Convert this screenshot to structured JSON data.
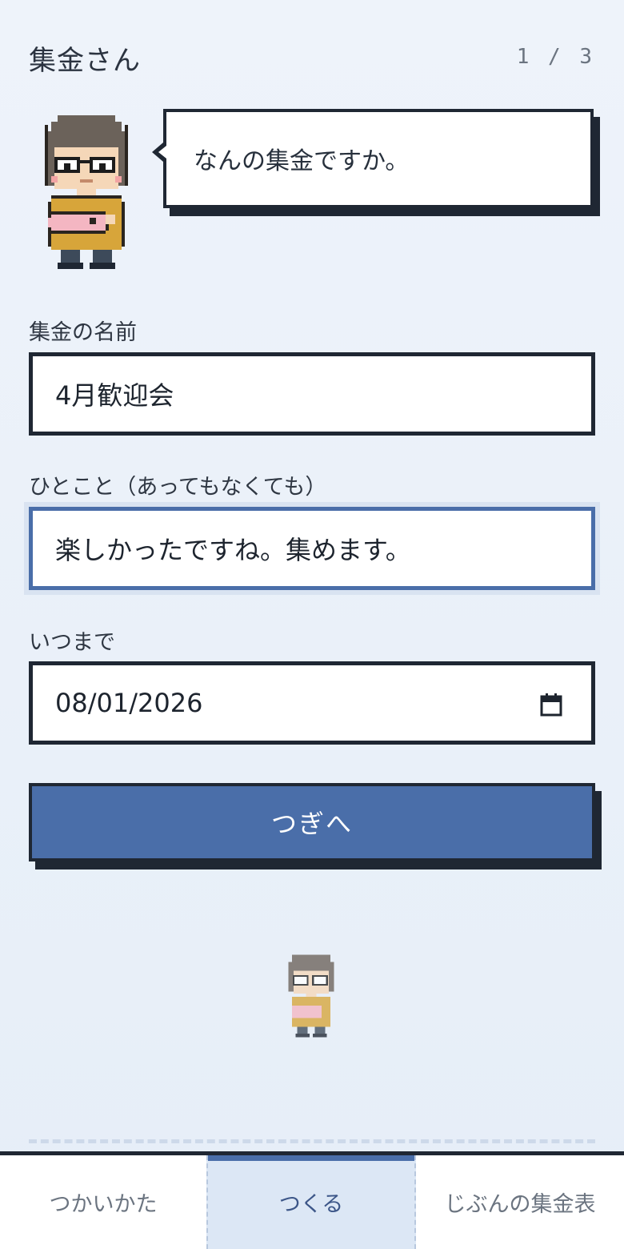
{
  "header": {
    "title": "集金さん",
    "step": "1 / 3"
  },
  "speech": {
    "text": "なんの集金ですか。"
  },
  "form": {
    "name": {
      "label": "集金の名前",
      "value": "4月歓迎会"
    },
    "comment": {
      "label": "ひとこと（あってもなくても）",
      "value": "楽しかったですね。集めます。"
    },
    "deadline": {
      "label": "いつまで",
      "value": "08/01/2026"
    }
  },
  "next_button": {
    "label": "つぎへ"
  },
  "tabs": [
    {
      "label": "つかいかた",
      "selected": false
    },
    {
      "label": "つくる",
      "selected": true
    },
    {
      "label": "じぶんの集金表",
      "selected": false
    }
  ],
  "icons": {
    "calendar": "calendar-icon",
    "mascot": "pixel-character"
  },
  "colors": {
    "accent": "#4a6ea9",
    "border": "#1f2733",
    "background": "#eaf0f8"
  }
}
